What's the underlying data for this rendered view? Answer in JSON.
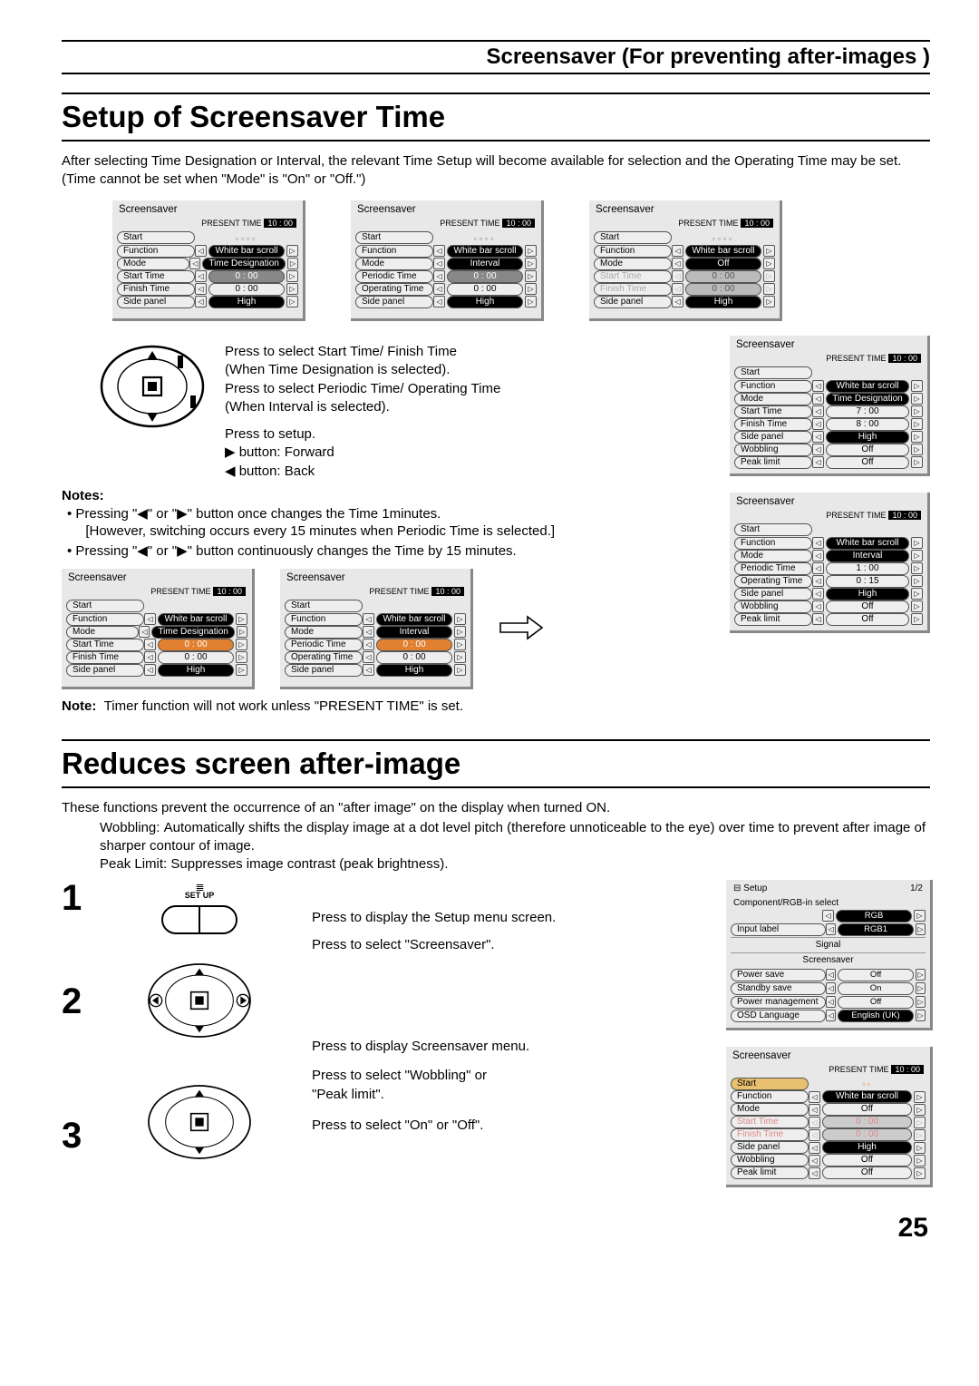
{
  "page_number": "25",
  "header": "Screensaver (For preventing after-images )",
  "section1": {
    "title": "Setup of Screensaver Time",
    "intro": "After selecting Time Designation or Interval, the relevant Time Setup will become available for selection and the Operating Time may be set. (Time cannot be set when \"Mode\" is \"On\" or \"Off.\")",
    "instr1": "Press to select Start Time/ Finish Time",
    "instr1b": "(When Time Designation is selected).",
    "instr2": "Press to select Periodic Time/ Operating Time",
    "instr2b": "(When Interval  is selected).",
    "instr3": "Press to setup.",
    "instr4a": "▶ button: Forward",
    "instr4b": "◀ button: Back",
    "notes_head": "Notes:",
    "note1": "Pressing \"◀\" or \"▶\" button once changes the Time 1minutes.",
    "note1b": "[However, switching occurs every 15 minutes when Periodic Time is selected.]",
    "note2": "Pressing \"◀\" or \"▶\" button continuously changes the Time by 15 minutes.",
    "bottom_note": "Note:  Timer function will not work unless \"PRESENT TIME\" is set."
  },
  "section2": {
    "title": "Reduces screen after-image",
    "intro": "These functions prevent the occurrence of an \"after image\" on the display when turned ON.",
    "wob_label": "Wobbling:",
    "wob_text": "Automatically shifts the display image at a dot level pitch (therefore unnoticeable to the eye) over time to prevent after image of sharper contour of image.",
    "peak_label": "Peak Limit:",
    "peak_text": "Suppresses image contrast (peak brightness).",
    "step_labels": {
      "1": "1",
      "2": "2",
      "3": "3"
    },
    "setup_label": "SET UP",
    "s1_text": "Press to display the Setup menu screen.",
    "s2_text": "Press to select \"Screensaver\".",
    "s2b_text": "Press to display Screensaver menu.",
    "s3_text": "Press to select \"Wobbling\" or \"Peak limit\".",
    "s3b_text": "Press to select \"On\" or \"Off\"."
  },
  "menu_common": {
    "title": "Screensaver",
    "present": "PRESENT TIME",
    "time": "10 : 00",
    "start": "Start",
    "function": "Function",
    "function_val": "White bar scroll",
    "mode": "Mode",
    "start_time": "Start Time",
    "finish_time": "Finish Time",
    "periodic_time": "Periodic Time",
    "operating_time": "Operating Time",
    "side_panel": "Side  panel",
    "wobbling": "Wobbling",
    "peak_limit": "Peak limit",
    "high": "High",
    "off": "Off",
    "on": "On",
    "zero": "0 : 00"
  },
  "menuA": {
    "mode": "Time Designation",
    "r1": "Start Time",
    "r2": "Finish Time",
    "v1": "0 : 00",
    "v2": "0 : 00"
  },
  "menuB": {
    "mode": "Interval",
    "r1": "Periodic Time",
    "r2": "Operating Time",
    "v1": "0 : 00",
    "v2": "0 : 00"
  },
  "menuC": {
    "mode": "Off",
    "disabled": true
  },
  "menuD": {
    "mode": "Time Designation",
    "r1": "Start Time",
    "r2": "Finish Time",
    "r3": "Side  panel",
    "r4": "Wobbling",
    "r5": "Peak limit",
    "v1": "7 : 00",
    "v2": "8 : 00",
    "v3": "High",
    "v4": "Off",
    "v5": "Off"
  },
  "menuE": {
    "mode": "Interval",
    "r1": "Periodic Time",
    "r2": "Operating Time",
    "r3": "Side  panel",
    "r4": "Wobbling",
    "r5": "Peak limit",
    "v1": "1 : 00",
    "v2": "0 : 15",
    "v3": "High",
    "v4": "Off",
    "v5": "Off"
  },
  "menuF": {
    "mode": "Time Designation",
    "r1": "Start Time",
    "r2": "Finish Time",
    "v1": "0 : 00",
    "v2": "0 : 00",
    "hl_r1": true
  },
  "menuG": {
    "mode": "Interval",
    "r1": "Periodic Time",
    "r2": "Operating Time",
    "v1": "0 : 00",
    "v2": "0 : 00",
    "hl_r1": true
  },
  "setup_menu": {
    "title": "Setup",
    "page": "1/2",
    "comp": "Component/RGB-in  select",
    "comp_val": "RGB",
    "input_label": "Input label",
    "input_val": "RGB1",
    "signal": "Signal",
    "screensaver": "Screensaver",
    "power_save": "Power save",
    "ps_val": "Off",
    "standby": "Standby save",
    "sb_val": "On",
    "pm": "Power management",
    "pm_val": "Off",
    "osd": "OSD  Language",
    "osd_val": "English (UK)"
  },
  "menuH": {
    "mode": "Off",
    "function_val": "White bar scroll",
    "rows": [
      {
        "label": "Start Time",
        "val": "0 : 00",
        "dim": true
      },
      {
        "label": "Finish Time",
        "val": "0 : 00",
        "dim": true
      },
      {
        "label": "Side  panel",
        "val": "High"
      },
      {
        "label": "Wobbling",
        "val": "Off"
      },
      {
        "label": "Peak limit",
        "val": "Off"
      }
    ]
  }
}
